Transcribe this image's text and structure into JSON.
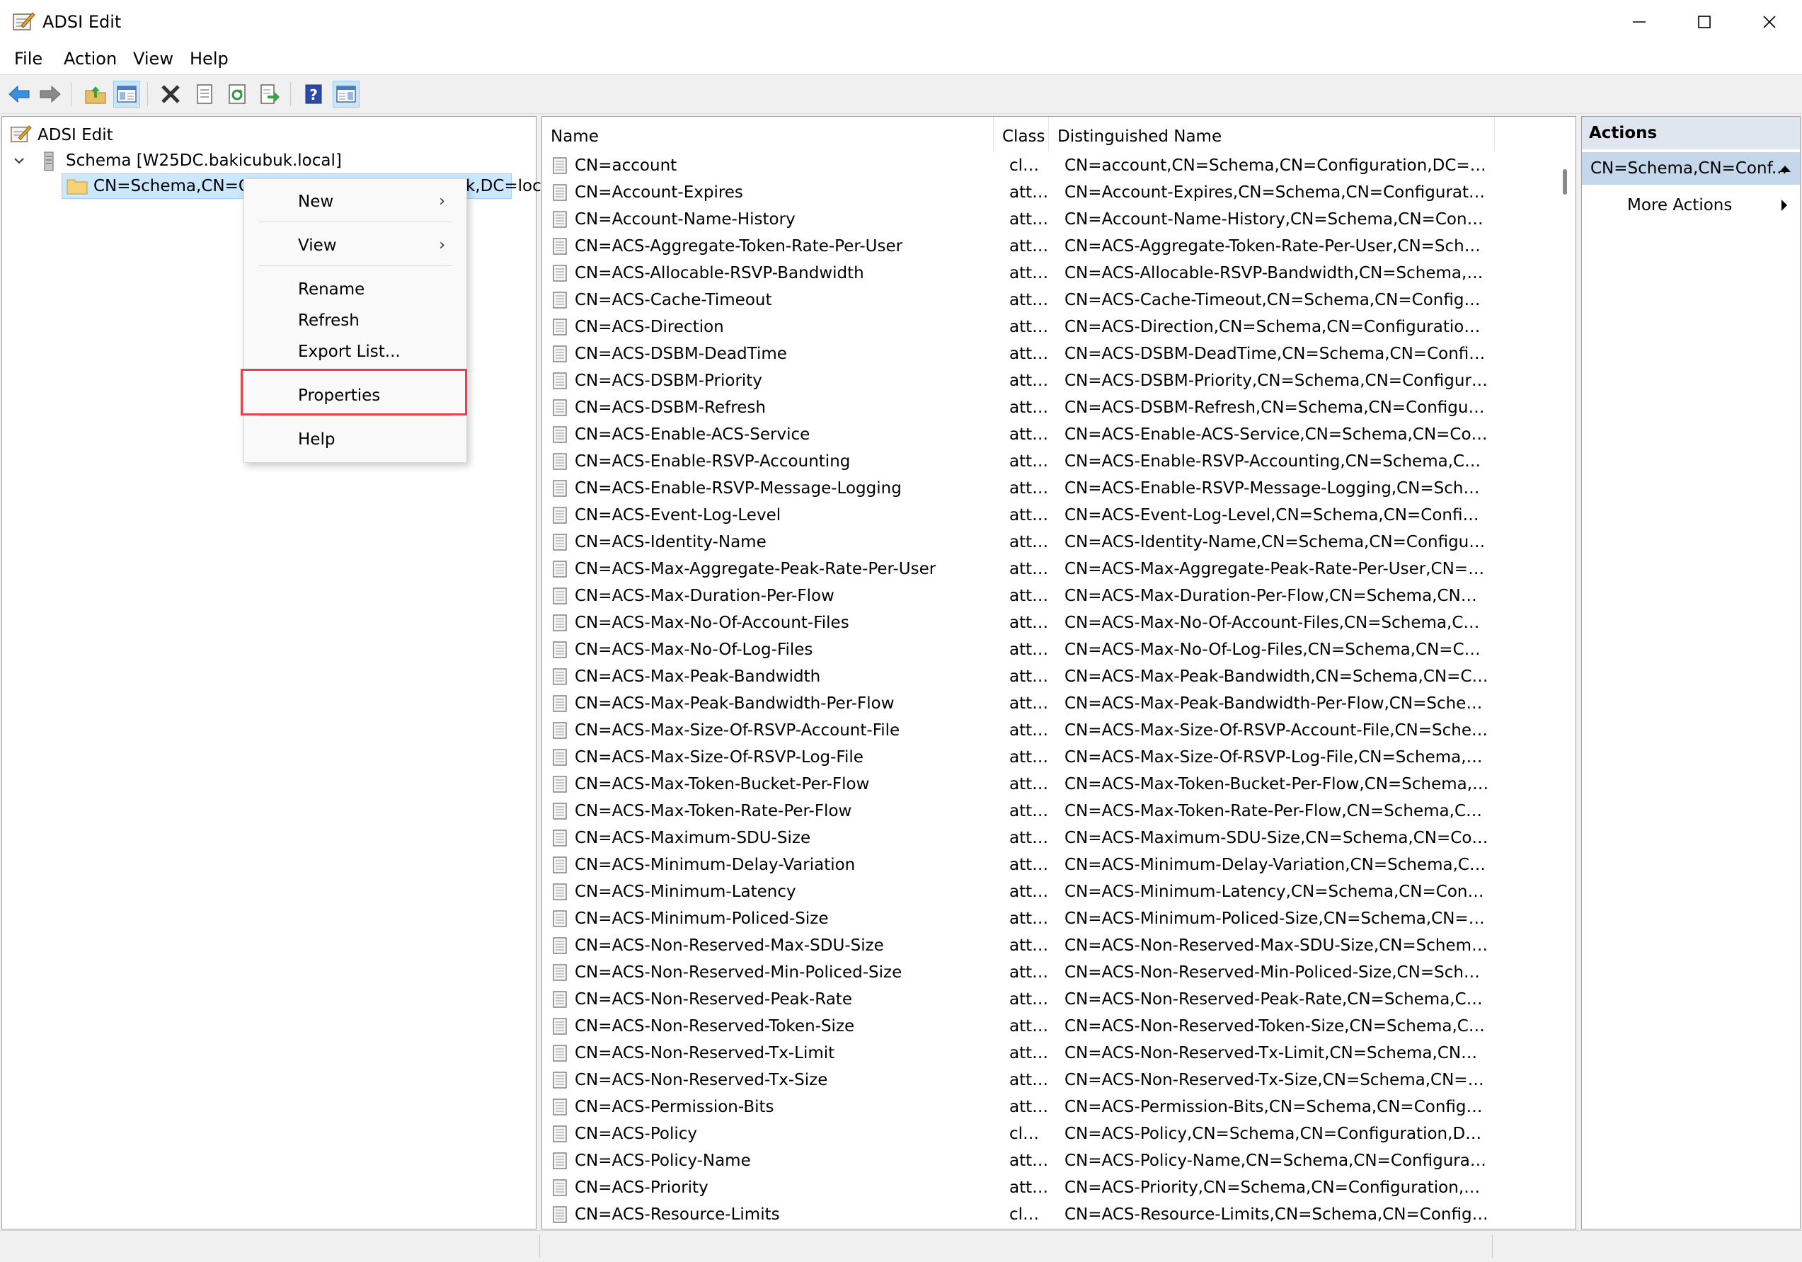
{
  "window": {
    "title": "ADSI Edit"
  },
  "menu": [
    "File",
    "Action",
    "View",
    "Help"
  ],
  "toolbar": {
    "buttons": [
      "back-icon",
      "forward-icon",
      "up-folder-icon",
      "show-tree-icon",
      "delete-icon",
      "properties-icon",
      "refresh-icon",
      "export-list-icon",
      "help-icon",
      "show-action-pane-icon"
    ]
  },
  "tree": {
    "root": "ADSI Edit",
    "schema": "Schema [W25DC.bakicubuk.local]",
    "selected": "CN=Schema,CN=Configuration,DC=bakicubuk,DC=local"
  },
  "context_menu": {
    "new": "New",
    "view": "View",
    "rename": "Rename",
    "refresh": "Refresh",
    "export": "Export List...",
    "properties": "Properties",
    "help": "Help",
    "submenu_arrow": "›"
  },
  "list": {
    "columns": {
      "name": "Name",
      "class": "Class",
      "dn": "Distinguished Name"
    },
    "rows": [
      {
        "name": "CN=account",
        "class": "clas...",
        "dn": "CN=account,CN=Schema,CN=Configuration,DC=bakicu..."
      },
      {
        "name": "CN=Account-Expires",
        "class": "attr...",
        "dn": "CN=Account-Expires,CN=Schema,CN=Configuration,DC..."
      },
      {
        "name": "CN=Account-Name-History",
        "class": "attr...",
        "dn": "CN=Account-Name-History,CN=Schema,CN=Configura..."
      },
      {
        "name": "CN=ACS-Aggregate-Token-Rate-Per-User",
        "class": "attr...",
        "dn": "CN=ACS-Aggregate-Token-Rate-Per-User,CN=Schema,C..."
      },
      {
        "name": "CN=ACS-Allocable-RSVP-Bandwidth",
        "class": "attr...",
        "dn": "CN=ACS-Allocable-RSVP-Bandwidth,CN=Schema,CN=C..."
      },
      {
        "name": "CN=ACS-Cache-Timeout",
        "class": "attr...",
        "dn": "CN=ACS-Cache-Timeout,CN=Schema,CN=Configuratio..."
      },
      {
        "name": "CN=ACS-Direction",
        "class": "attr...",
        "dn": "CN=ACS-Direction,CN=Schema,CN=Configuration,DC=..."
      },
      {
        "name": "CN=ACS-DSBM-DeadTime",
        "class": "attr...",
        "dn": "CN=ACS-DSBM-DeadTime,CN=Schema,CN=Configurati..."
      },
      {
        "name": "CN=ACS-DSBM-Priority",
        "class": "attr...",
        "dn": "CN=ACS-DSBM-Priority,CN=Schema,CN=Configuration,..."
      },
      {
        "name": "CN=ACS-DSBM-Refresh",
        "class": "attr...",
        "dn": "CN=ACS-DSBM-Refresh,CN=Schema,CN=Configuration..."
      },
      {
        "name": "CN=ACS-Enable-ACS-Service",
        "class": "attr...",
        "dn": "CN=ACS-Enable-ACS-Service,CN=Schema,CN=Configur..."
      },
      {
        "name": "CN=ACS-Enable-RSVP-Accounting",
        "class": "attr...",
        "dn": "CN=ACS-Enable-RSVP-Accounting,CN=Schema,CN=Co..."
      },
      {
        "name": "CN=ACS-Enable-RSVP-Message-Logging",
        "class": "attr...",
        "dn": "CN=ACS-Enable-RSVP-Message-Logging,CN=Schema,C..."
      },
      {
        "name": "CN=ACS-Event-Log-Level",
        "class": "attr...",
        "dn": "CN=ACS-Event-Log-Level,CN=Schema,CN=Configuratio..."
      },
      {
        "name": "CN=ACS-Identity-Name",
        "class": "attr...",
        "dn": "CN=ACS-Identity-Name,CN=Schema,CN=Configuration..."
      },
      {
        "name": "CN=ACS-Max-Aggregate-Peak-Rate-Per-User",
        "class": "attr...",
        "dn": "CN=ACS-Max-Aggregate-Peak-Rate-Per-User,CN=Sche..."
      },
      {
        "name": "CN=ACS-Max-Duration-Per-Flow",
        "class": "attr...",
        "dn": "CN=ACS-Max-Duration-Per-Flow,CN=Schema,CN=Conf..."
      },
      {
        "name": "CN=ACS-Max-No-Of-Account-Files",
        "class": "attr...",
        "dn": "CN=ACS-Max-No-Of-Account-Files,CN=Schema,CN=Co..."
      },
      {
        "name": "CN=ACS-Max-No-Of-Log-Files",
        "class": "attr...",
        "dn": "CN=ACS-Max-No-Of-Log-Files,CN=Schema,CN=Config..."
      },
      {
        "name": "CN=ACS-Max-Peak-Bandwidth",
        "class": "attr...",
        "dn": "CN=ACS-Max-Peak-Bandwidth,CN=Schema,CN=Config..."
      },
      {
        "name": "CN=ACS-Max-Peak-Bandwidth-Per-Flow",
        "class": "attr...",
        "dn": "CN=ACS-Max-Peak-Bandwidth-Per-Flow,CN=Schema,C..."
      },
      {
        "name": "CN=ACS-Max-Size-Of-RSVP-Account-File",
        "class": "attr...",
        "dn": "CN=ACS-Max-Size-Of-RSVP-Account-File,CN=Schema,C..."
      },
      {
        "name": "CN=ACS-Max-Size-Of-RSVP-Log-File",
        "class": "attr...",
        "dn": "CN=ACS-Max-Size-Of-RSVP-Log-File,CN=Schema,CN=C..."
      },
      {
        "name": "CN=ACS-Max-Token-Bucket-Per-Flow",
        "class": "attr...",
        "dn": "CN=ACS-Max-Token-Bucket-Per-Flow,CN=Schema,CN=..."
      },
      {
        "name": "CN=ACS-Max-Token-Rate-Per-Flow",
        "class": "attr...",
        "dn": "CN=ACS-Max-Token-Rate-Per-Flow,CN=Schema,CN=Co..."
      },
      {
        "name": "CN=ACS-Maximum-SDU-Size",
        "class": "attr...",
        "dn": "CN=ACS-Maximum-SDU-Size,CN=Schema,CN=Configur..."
      },
      {
        "name": "CN=ACS-Minimum-Delay-Variation",
        "class": "attr...",
        "dn": "CN=ACS-Minimum-Delay-Variation,CN=Schema,CN=Co..."
      },
      {
        "name": "CN=ACS-Minimum-Latency",
        "class": "attr...",
        "dn": "CN=ACS-Minimum-Latency,CN=Schema,CN=Configura..."
      },
      {
        "name": "CN=ACS-Minimum-Policed-Size",
        "class": "attr...",
        "dn": "CN=ACS-Minimum-Policed-Size,CN=Schema,CN=Confi..."
      },
      {
        "name": "CN=ACS-Non-Reserved-Max-SDU-Size",
        "class": "attr...",
        "dn": "CN=ACS-Non-Reserved-Max-SDU-Size,CN=Schema,CN..."
      },
      {
        "name": "CN=ACS-Non-Reserved-Min-Policed-Size",
        "class": "attr...",
        "dn": "CN=ACS-Non-Reserved-Min-Policed-Size,CN=Schema,..."
      },
      {
        "name": "CN=ACS-Non-Reserved-Peak-Rate",
        "class": "attr...",
        "dn": "CN=ACS-Non-Reserved-Peak-Rate,CN=Schema,CN=Co..."
      },
      {
        "name": "CN=ACS-Non-Reserved-Token-Size",
        "class": "attr...",
        "dn": "CN=ACS-Non-Reserved-Token-Size,CN=Schema,CN=Co..."
      },
      {
        "name": "CN=ACS-Non-Reserved-Tx-Limit",
        "class": "attr...",
        "dn": "CN=ACS-Non-Reserved-Tx-Limit,CN=Schema,CN=Confi..."
      },
      {
        "name": "CN=ACS-Non-Reserved-Tx-Size",
        "class": "attr...",
        "dn": "CN=ACS-Non-Reserved-Tx-Size,CN=Schema,CN=Config..."
      },
      {
        "name": "CN=ACS-Permission-Bits",
        "class": "attr...",
        "dn": "CN=ACS-Permission-Bits,CN=Schema,CN=Configuratio..."
      },
      {
        "name": "CN=ACS-Policy",
        "class": "clas...",
        "dn": "CN=ACS-Policy,CN=Schema,CN=Configuration,DC=baki..."
      },
      {
        "name": "CN=ACS-Policy-Name",
        "class": "attr...",
        "dn": "CN=ACS-Policy-Name,CN=Schema,CN=Configuration,D..."
      },
      {
        "name": "CN=ACS-Priority",
        "class": "attr...",
        "dn": "CN=ACS-Priority,CN=Schema,CN=Configuration,DC=ba..."
      },
      {
        "name": "CN=ACS-Resource-Limits",
        "class": "clas...",
        "dn": "CN=ACS-Resource-Limits,CN=Schema,CN=Configuratio..."
      }
    ]
  },
  "actions": {
    "title": "Actions",
    "section": "CN=Schema,CN=Conf...",
    "more": "More Actions"
  }
}
